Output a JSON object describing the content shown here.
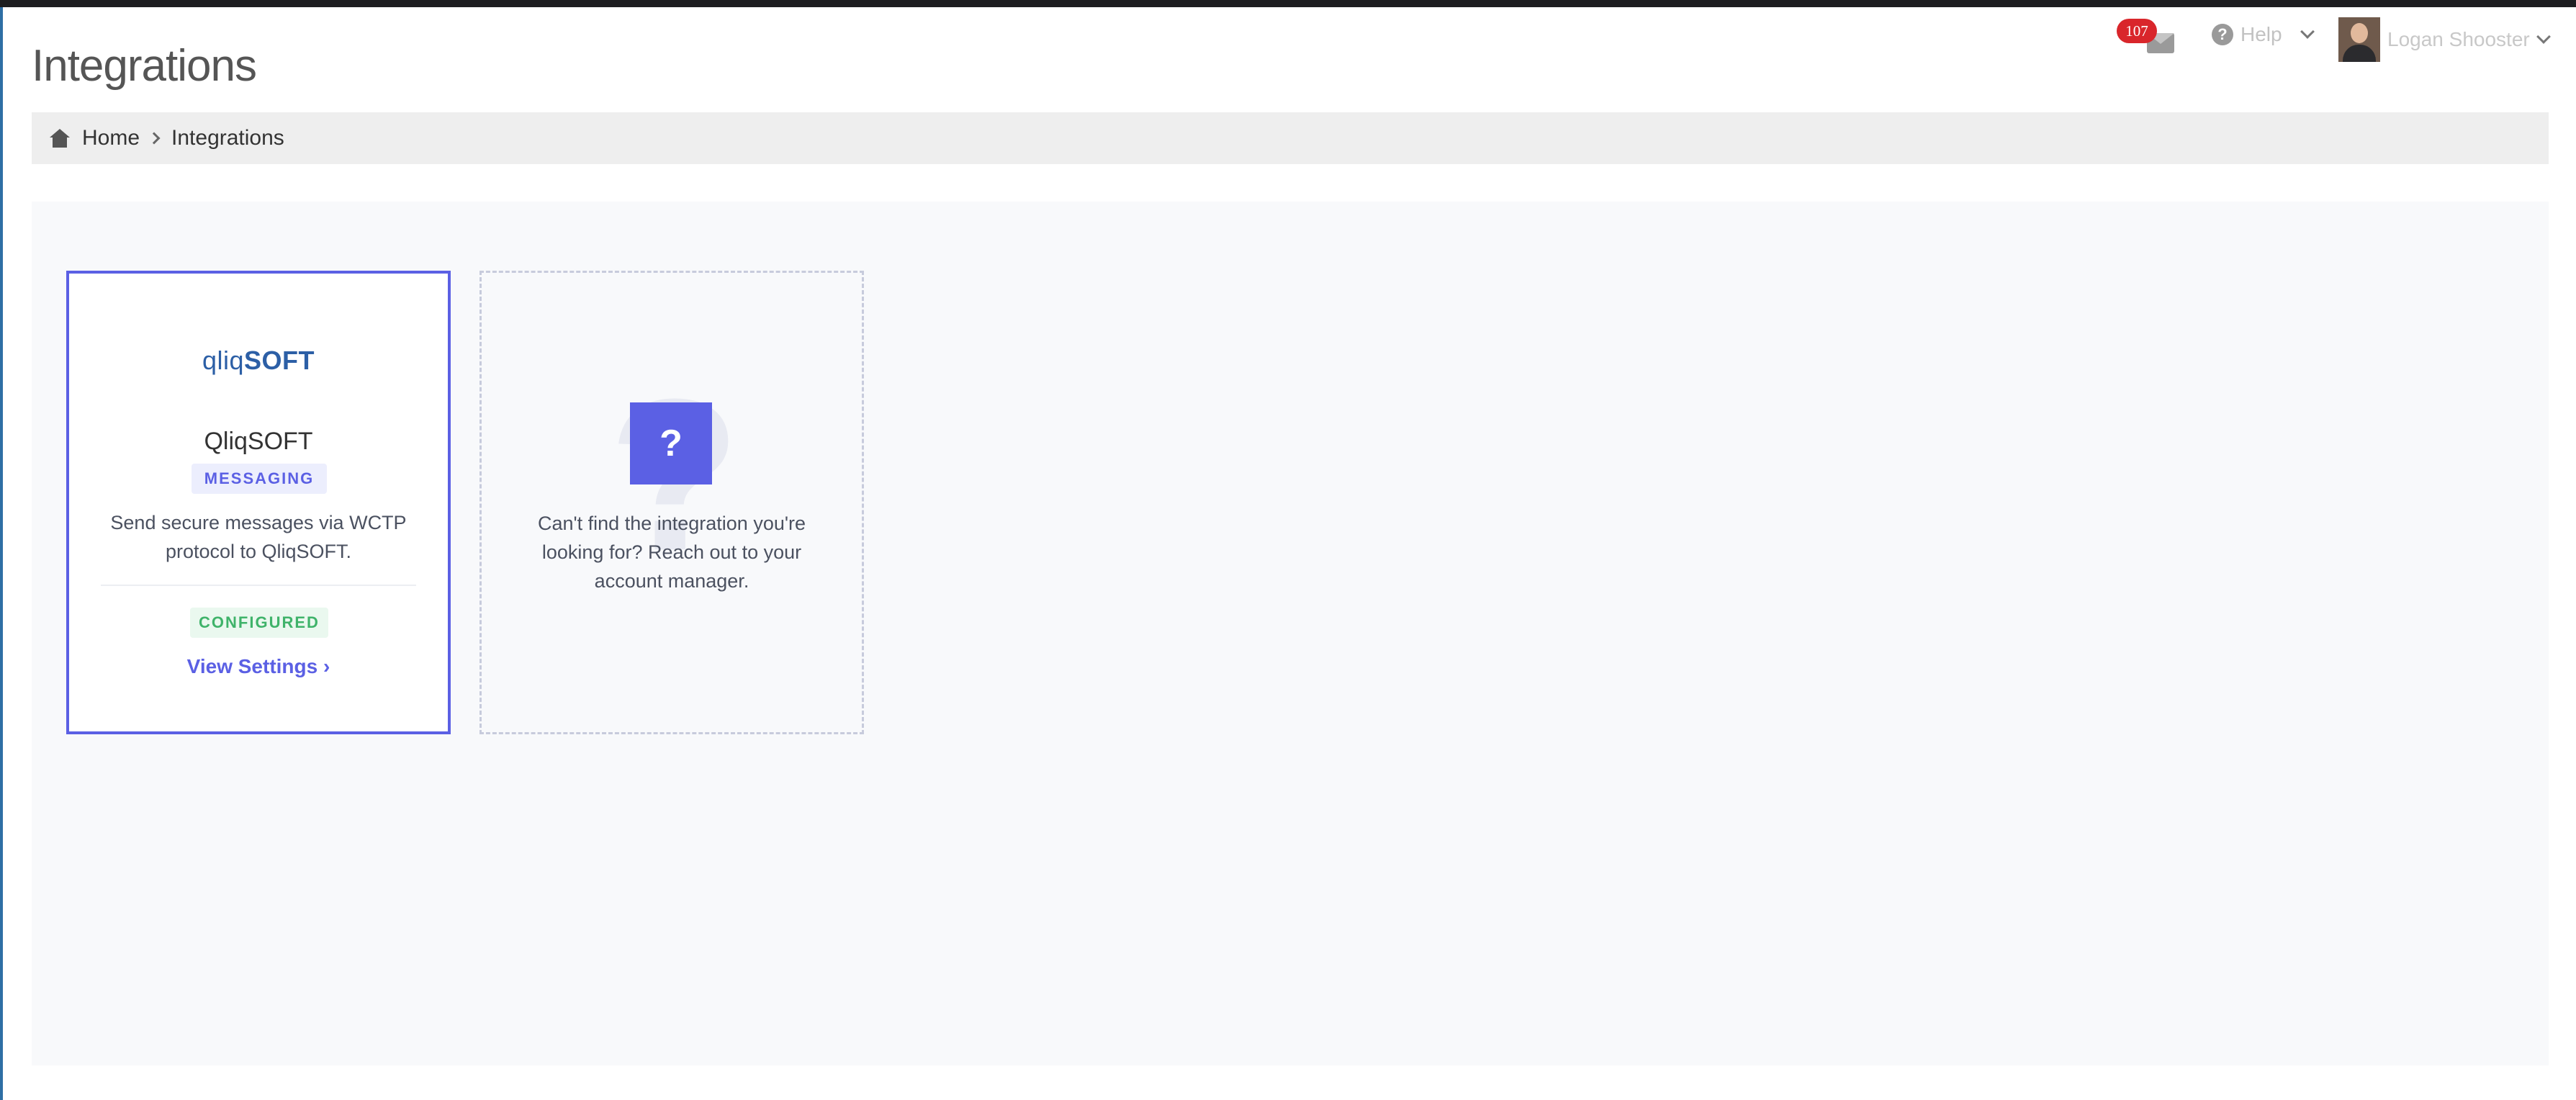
{
  "page": {
    "title": "Integrations"
  },
  "header": {
    "messages": {
      "count": "107",
      "icon": "envelope-icon"
    },
    "help": {
      "label": "Help",
      "icon": "question-circle-icon"
    },
    "user": {
      "name": "Logan Shooster",
      "icon": "chevron-down-icon"
    }
  },
  "breadcrumb": {
    "items": [
      {
        "label": "Home",
        "icon": "home-icon"
      },
      {
        "label": "Integrations"
      }
    ]
  },
  "integrations": [
    {
      "logo_thin": "qliq",
      "logo_bold": "SOFT",
      "name": "QliqSOFT",
      "category": "MESSAGING",
      "description": "Send secure messages via WCTP protocol to QliqSOFT.",
      "status": "CONFIGURED",
      "link_label": "View Settings ›"
    }
  ],
  "placeholder": {
    "symbol": "?",
    "text": "Can't find the integration you're looking for? Reach out to your account manager."
  },
  "colors": {
    "accent": "#5b60e4",
    "configured": "#3fb36a",
    "badge": "#d9262b"
  }
}
